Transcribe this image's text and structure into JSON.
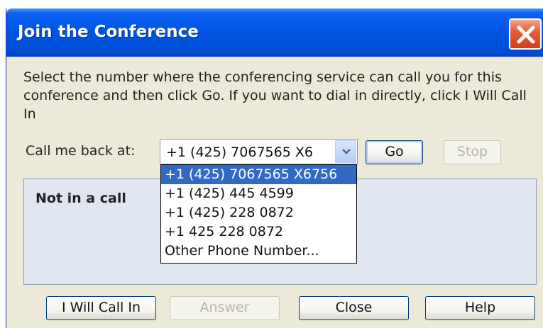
{
  "window": {
    "title": "Join the Conference"
  },
  "instructions": "Select the number where the conferencing service can call you for this conference and then click Go. If you want to dial in directly, click I Will Call In",
  "callback": {
    "label": "Call me back at:",
    "selected_value": "+1 (425) 7067565 X6",
    "options": [
      "+1 (425) 7067565 X6756",
      "+1 (425) 445 4599",
      "+1 (425) 228 0872",
      "+1 425 228 0872",
      "Other Phone Number..."
    ]
  },
  "buttons": {
    "go": "Go",
    "stop": "Stop",
    "i_will_call_in": "I Will Call In",
    "answer": "Answer",
    "close": "Close",
    "help": "Help"
  },
  "status": {
    "text": "Not in a call"
  },
  "colors": {
    "titlebar": "#0054e3",
    "selection": "#316ac5",
    "close_button": "#d43d1a",
    "panel": "#dfe6ef"
  }
}
